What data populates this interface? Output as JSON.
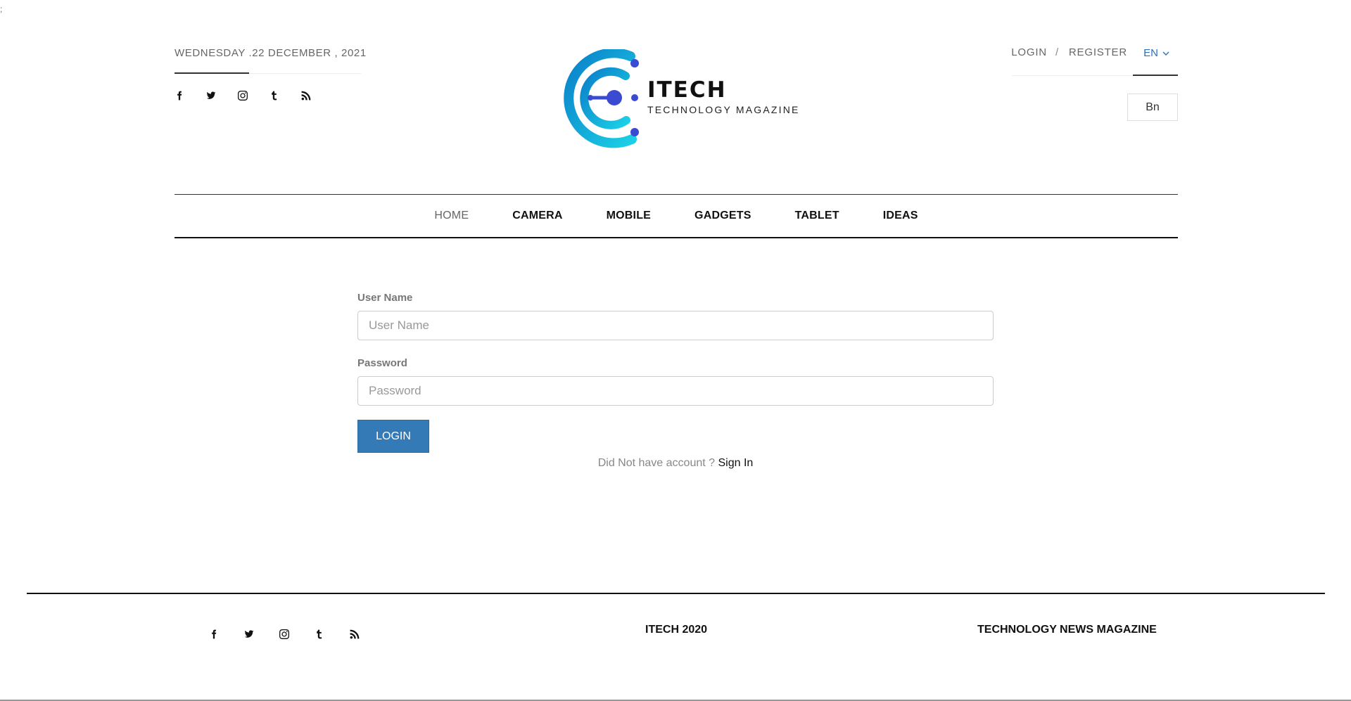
{
  "stray_char": ";",
  "header": {
    "date": "WEDNESDAY .22 DECEMBER , 2021",
    "social_icons": [
      "facebook-icon",
      "twitter-icon",
      "instagram-icon",
      "tumblr-icon",
      "rss-icon"
    ],
    "logo": {
      "title": "ITECH",
      "subtitle": "TECHNOLOGY MAGAZINE",
      "colors": {
        "ring_light": "#1bb6e0",
        "ring_dark": "#0a7fc9",
        "dot": "#3b4bd1"
      }
    },
    "auth": {
      "login_label": "LOGIN",
      "separator": "/",
      "register_label": "REGISTER",
      "language": "EN",
      "language_option": "Bn"
    }
  },
  "nav": {
    "items": [
      {
        "label": "HOME",
        "active": true
      },
      {
        "label": "CAMERA"
      },
      {
        "label": "MOBILE"
      },
      {
        "label": "GADGETS"
      },
      {
        "label": "TABLET"
      },
      {
        "label": "IDEAS"
      }
    ]
  },
  "form": {
    "username_label": "User Name",
    "username_placeholder": "User Name",
    "username_value": "",
    "password_label": "Password",
    "password_placeholder": "Password",
    "password_value": "",
    "submit_label": "LOGIN",
    "signup_prompt": "Did Not have account ?",
    "signup_link": "Sign In",
    "accent_color": "#337ab7"
  },
  "footer": {
    "social_icons": [
      "facebook-icon",
      "twitter-icon",
      "instagram-icon",
      "tumblr-icon",
      "rss-icon"
    ],
    "center_text": "ITECH 2020",
    "right_text": "TECHNOLOGY NEWS MAGAZINE"
  }
}
